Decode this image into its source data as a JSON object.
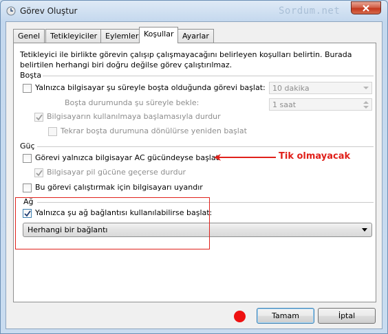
{
  "window": {
    "title": "Görev Oluştur",
    "watermark": "Sordum.net"
  },
  "tabs": [
    {
      "label": "Genel"
    },
    {
      "label": "Tetikleyiciler"
    },
    {
      "label": "Eylemler"
    },
    {
      "label": "Koşullar",
      "active": true
    },
    {
      "label": "Ayarlar"
    }
  ],
  "description": "Tetikleyici ile birlikte görevin çalışıp çalışmayacağını belirleyen koşulları belirtin. Burada belirtilen herhangi biri doğru değilse görev çalıştırılmaz.",
  "idle": {
    "group_label": "Boşta",
    "start_if_idle": {
      "label": "Yalnızca bilgisayar şu süreyle boşta olduğunda görevi başlat:",
      "checked": false
    },
    "idle_duration": {
      "value": "10 dakika"
    },
    "wait_label": "Boşta durumunda şu süreyle bekle:",
    "wait_duration": {
      "value": "1 saat"
    },
    "stop_if_busy": {
      "label": "Bilgisayarın kullanılmaya başlamasıyla durdur",
      "checked": true,
      "disabled": true
    },
    "restart_if_idle": {
      "label": "Tekrar boşta durumuna dönülürse yeniden başlat",
      "checked": false,
      "disabled": true
    }
  },
  "power": {
    "group_label": "Güç",
    "ac_only": {
      "label": "Görevi yalnızca bilgisayar AC gücündeyse başlat",
      "checked": false
    },
    "stop_on_battery": {
      "label": "Bilgisayar pil gücüne geçerse durdur",
      "checked": true,
      "disabled": true
    },
    "wake_to_run": {
      "label": "Bu görevi çalıştırmak için bilgisayarı uyandır",
      "checked": false
    }
  },
  "network": {
    "group_label": "Ağ",
    "only_if_network": {
      "label": "Yalnızca şu ağ bağlantısı kullanılabilirse başlat:",
      "checked": true
    },
    "connection": {
      "value": "Herhangi bir bağlantı"
    }
  },
  "annotation": {
    "text": "Tik olmayacak",
    "color": "#e0201a"
  },
  "buttons": {
    "ok": "Tamam",
    "cancel": "İptal"
  }
}
